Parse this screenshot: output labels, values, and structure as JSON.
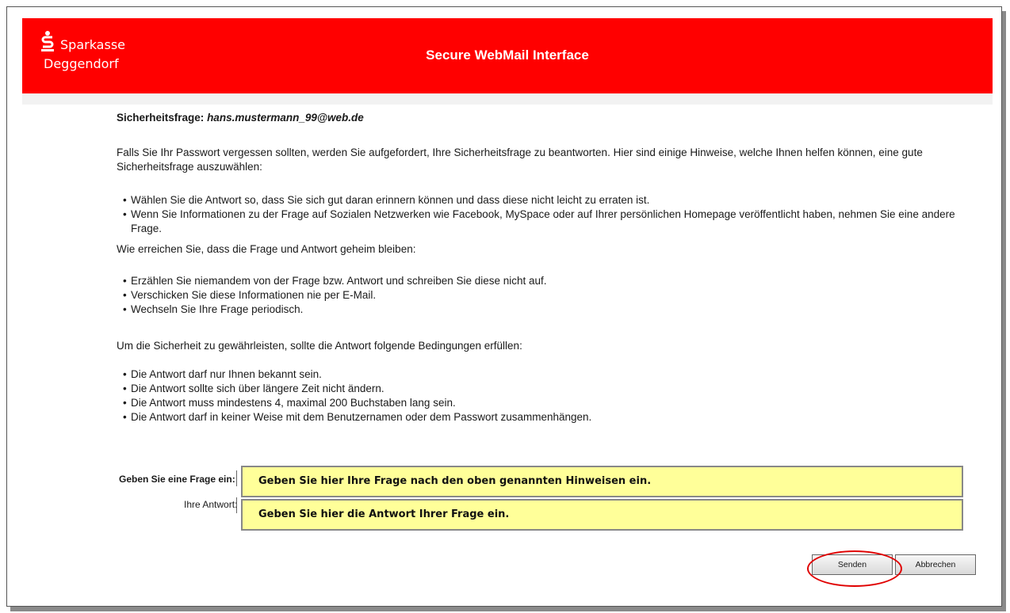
{
  "header": {
    "brand_name": "Sparkasse",
    "brand_city": "Deggendorf",
    "title": "Secure WebMail Interface",
    "background": "#ff0000"
  },
  "security": {
    "label": "Sicherheitsfrage:",
    "email": "hans.mustermann_99@web.de"
  },
  "intro": "Falls Sie Ihr Passwort vergessen sollten, werden Sie aufgefordert, Ihre Sicherheitsfrage zu beantworten. Hier sind einige Hinweise, welche Ihnen helfen können, eine gute Sicherheitsfrage auszuwählen:",
  "tips": [
    "Wählen Sie die Antwort so, dass Sie sich gut daran erinnern können und dass diese nicht leicht zu erraten ist.",
    "Wenn Sie Informationen zu der Frage auf Sozialen Netzwerken wie Facebook, MySpace oder auf Ihrer persönlichen Homepage veröffentlicht haben, nehmen Sie eine andere Frage."
  ],
  "secret_heading": "Wie erreichen Sie, dass die Frage und Antwort geheim bleiben:",
  "secret_tips": [
    "Erzählen Sie niemandem von der Frage bzw. Antwort und schreiben Sie diese nicht auf.",
    "Verschicken Sie diese Informationen nie per E-Mail.",
    "Wechseln Sie Ihre Frage periodisch."
  ],
  "conditions_heading": "Um die Sicherheit zu gewährleisten, sollte die Antwort folgende Bedingungen erfüllen:",
  "conditions": [
    "Die Antwort darf nur Ihnen bekannt sein.",
    "Die Antwort sollte sich über längere Zeit nicht ändern.",
    "Die Antwort muss mindestens 4, maximal 200 Buchstaben lang sein.",
    "Die Antwort darf in keiner Weise mit dem Benutzernamen oder dem Passwort zusammenhängen."
  ],
  "form": {
    "question_label": "Geben Sie eine Frage ein:",
    "answer_label": "Ihre Antwort:",
    "question_note": "Geben Sie hier Ihre Frage nach den oben genannten Hinweisen ein.",
    "answer_note": "Geben Sie hier die Antwort Ihrer Frage ein.",
    "note_color": "#ffff99"
  },
  "buttons": {
    "submit": "Senden",
    "cancel": "Abbrechen",
    "highlight_color": "#e00000"
  }
}
